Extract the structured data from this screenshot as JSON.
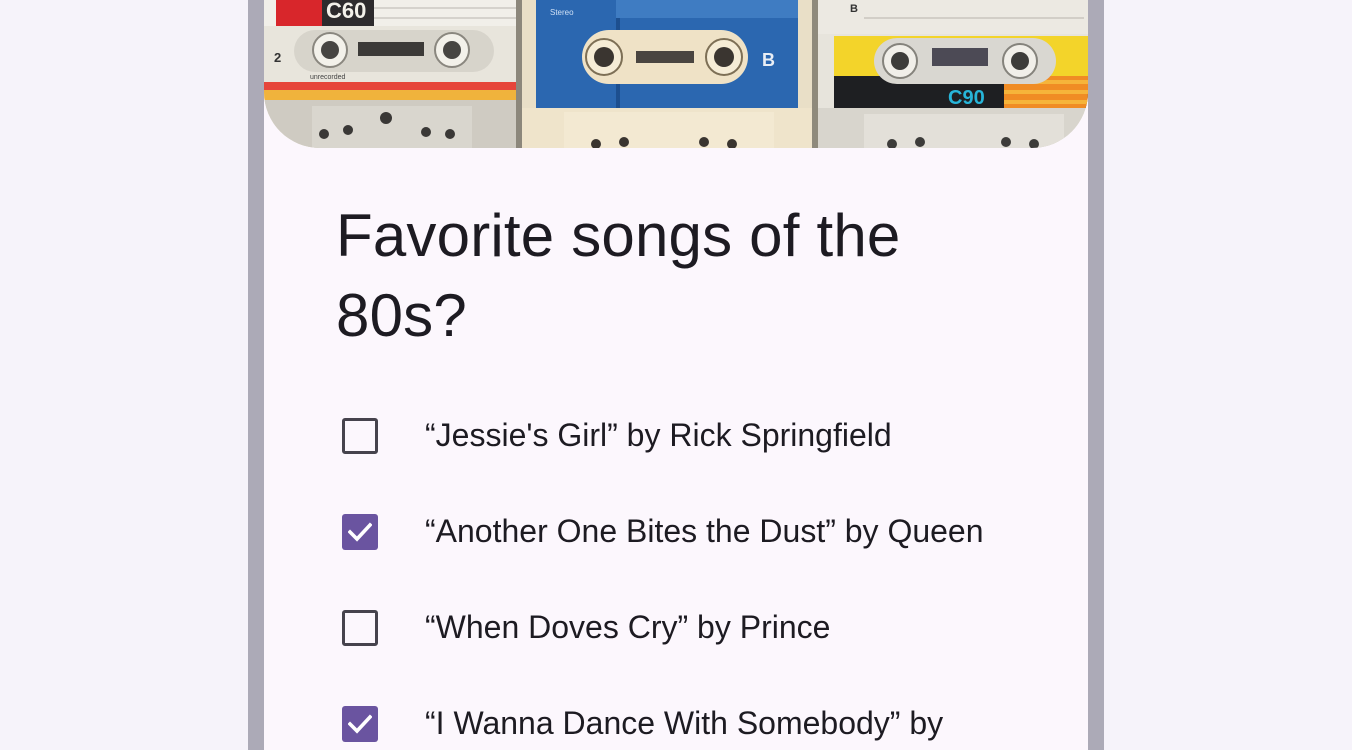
{
  "form": {
    "title": "Favorite songs of the 80s?",
    "header_image": {
      "tape_labels": {
        "left": "C60",
        "left_side": "2",
        "left_note": "unrecorded",
        "middle_brand": "Stereo",
        "middle_side": "B",
        "right_side": "B",
        "right": "C90"
      }
    },
    "options": [
      {
        "label": "“Jessie's Girl” by Rick Springfield",
        "checked": false
      },
      {
        "label": "“Another One Bites the Dust” by Queen",
        "checked": true
      },
      {
        "label": "“When Doves Cry” by Prince",
        "checked": false
      },
      {
        "label": "“I Wanna Dance With Somebody” by",
        "checked": true
      }
    ]
  },
  "colors": {
    "page_background": "#f6f3fa",
    "frame": "#acaab7",
    "card": "#fcf7fd",
    "checkbox_checked": "#6a54a0",
    "checkbox_border": "#46434d",
    "text": "#1d1b22"
  }
}
